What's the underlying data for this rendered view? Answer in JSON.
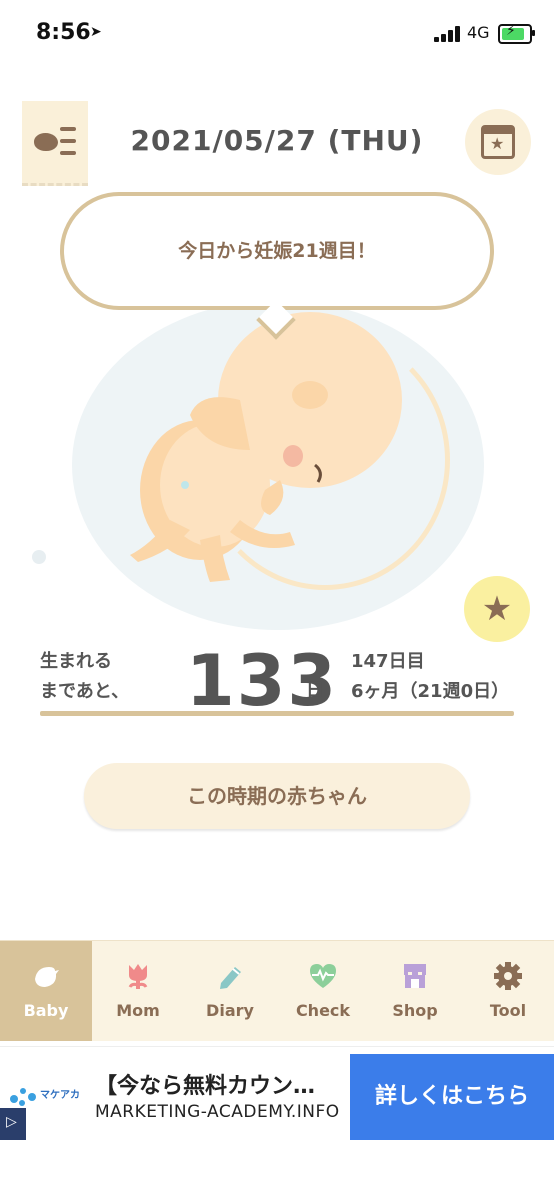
{
  "status_bar": {
    "time": "8:56",
    "network": "4G"
  },
  "header": {
    "date": "2021/05/27 (THU)",
    "menu_icon": "baby-list-icon",
    "calendar_icon": "calendar-star-icon"
  },
  "message": {
    "text": "今日から妊娠21週目！"
  },
  "countdown": {
    "label_line1": "生まれる",
    "label_line2": "まであと、",
    "days_remaining": "133",
    "unit": "日",
    "day_count": "147日目",
    "month_week": "6ヶ月（21週0日）"
  },
  "baby_button": {
    "label": "この時期の赤ちゃん"
  },
  "tabs": [
    {
      "label": "Baby",
      "icon": "bird-icon",
      "active": true
    },
    {
      "label": "Mom",
      "icon": "tulip-icon",
      "active": false
    },
    {
      "label": "Diary",
      "icon": "pencil-icon",
      "active": false
    },
    {
      "label": "Check",
      "icon": "heart-pulse-icon",
      "active": false
    },
    {
      "label": "Shop",
      "icon": "shop-icon",
      "active": false
    },
    {
      "label": "Tool",
      "icon": "gear-icon",
      "active": false
    }
  ],
  "ad": {
    "brand": "マケアカ",
    "title": "【今なら無料カウン…",
    "url": "MARKETING-ACADEMY.INFO",
    "cta": "詳しくはこちら"
  },
  "colors": {
    "accent_brown": "#8a6d55",
    "accent_gold": "#d8c39a",
    "cream": "#faf0dc",
    "ad_blue": "#3b7dea",
    "star_yellow": "#faf0a0"
  }
}
